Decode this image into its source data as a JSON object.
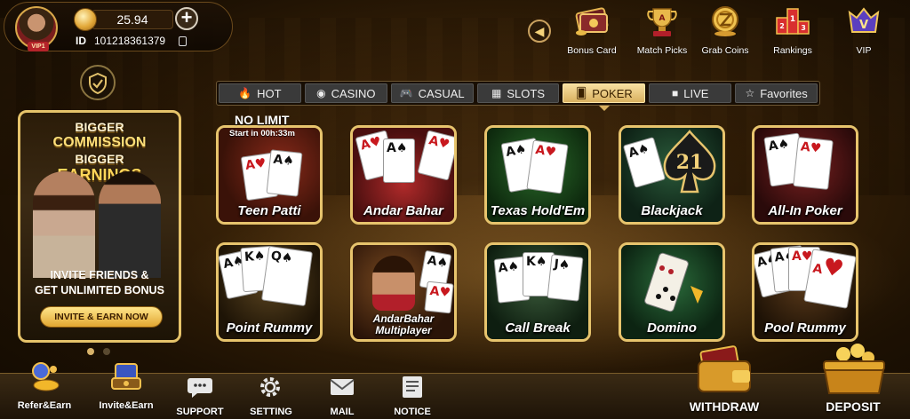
{
  "profile": {
    "vip_badge": "VIP1",
    "balance": "25.94",
    "add_label": "+",
    "id_label": "ID",
    "id_value": "101218361379"
  },
  "top_features": [
    {
      "label": "Bonus Card",
      "icon": "bonus-card-icon"
    },
    {
      "label": "Match Picks",
      "icon": "trophy-icon"
    },
    {
      "label": "Grab Coins",
      "icon": "grab-coins-icon"
    },
    {
      "label": "Rankings",
      "icon": "podium-icon"
    },
    {
      "label": "VIP",
      "icon": "vip-crown-icon"
    }
  ],
  "promo": {
    "line1": "BIGGER",
    "line2": "COMMISSION",
    "line3": "BIGGER",
    "line4": "EARNINGS",
    "invite1": "INVITE FRIENDS &",
    "invite2": "GET UNLIMITED BONUS",
    "button": "INVITE & EARN NOW"
  },
  "tabs": [
    {
      "label": "HOT",
      "icon": "flame-icon",
      "active": false
    },
    {
      "label": "CASINO",
      "icon": "casino-chip-icon",
      "active": false
    },
    {
      "label": "CASUAL",
      "icon": "gamepad-icon",
      "active": false
    },
    {
      "label": "SLOTS",
      "icon": "slot-machine-icon",
      "active": false
    },
    {
      "label": "POKER",
      "icon": "cards-icon",
      "active": true
    },
    {
      "label": "LIVE",
      "icon": "video-camera-icon",
      "active": false
    },
    {
      "label": "Favorites",
      "icon": "star-icon",
      "active": false
    }
  ],
  "teen_patti_promo": {
    "title": "NO LIMIT",
    "countdown": "Start in 00h:33m"
  },
  "games": [
    {
      "label": "Teen Patti"
    },
    {
      "label": "Andar Bahar"
    },
    {
      "label": "Texas Hold'Em"
    },
    {
      "label": "Blackjack"
    },
    {
      "label": "All-In Poker"
    },
    {
      "label": "Point Rummy"
    },
    {
      "label": "AndarBahar",
      "label2": "Multiplayer"
    },
    {
      "label": "Call Break"
    },
    {
      "label": "Domino"
    },
    {
      "label": "Pool Rummy"
    }
  ],
  "bottom_nav": [
    {
      "label": "Refer&Earn",
      "icon": "refer-earn-icon"
    },
    {
      "label": "Invite&Earn",
      "icon": "invite-earn-icon"
    },
    {
      "label": "SUPPORT",
      "icon": "chat-bubble-icon"
    },
    {
      "label": "SETTING",
      "icon": "gear-icon"
    },
    {
      "label": "MAIL",
      "icon": "envelope-icon"
    },
    {
      "label": "NOTICE",
      "icon": "notice-icon"
    },
    {
      "label": "WITHDRAW",
      "icon": "wallet-icon"
    },
    {
      "label": "DEPOSIT",
      "icon": "treasure-chest-icon"
    }
  ],
  "game_cards": {
    "card_ace": "A",
    "card_king": "K",
    "card_queen": "Q",
    "card_jack": "J",
    "blackjack_number": "21"
  },
  "colors": {
    "accent_gold": "#e7c46d",
    "active_tab": "#d9b160",
    "background": "#2d1c08"
  }
}
